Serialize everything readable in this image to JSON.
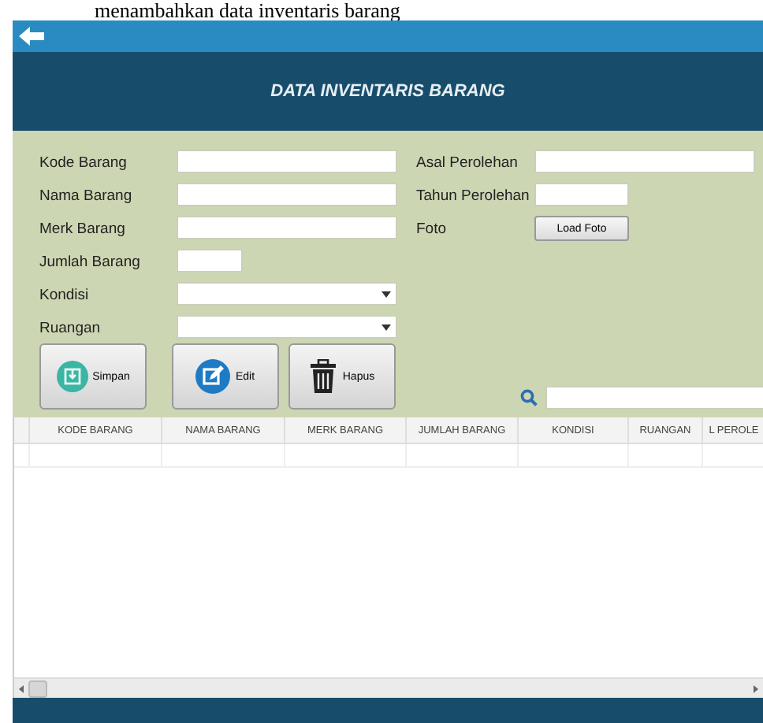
{
  "caption": "menambahkan data inventaris barang",
  "header": {
    "title": "DATA INVENTARIS BARANG"
  },
  "left_fields": [
    {
      "label": "Kode Barang",
      "kind": "text"
    },
    {
      "label": "Nama Barang",
      "kind": "text"
    },
    {
      "label": "Merk Barang",
      "kind": "text"
    },
    {
      "label": "Jumlah Barang",
      "kind": "number"
    },
    {
      "label": "Kondisi",
      "kind": "dropdown"
    },
    {
      "label": "Ruangan",
      "kind": "dropdown"
    }
  ],
  "right_fields": [
    {
      "label": "Asal Perolehan",
      "kind": "text"
    },
    {
      "label": "Tahun Perolehan",
      "kind": "number"
    },
    {
      "label": "Foto",
      "kind": "button",
      "button_label": "Load Foto"
    }
  ],
  "buttons": [
    {
      "label": "Simpan",
      "kind": "save"
    },
    {
      "label": "Edit",
      "kind": "edit"
    },
    {
      "label": "Hapus",
      "kind": "delete"
    }
  ],
  "table": {
    "columns": [
      "KODE BARANG",
      "NAMA BARANG",
      "MERK BARANG",
      "JUMLAH BARANG",
      "KONDISI",
      "RUANGAN",
      "L PEROLE"
    ]
  }
}
